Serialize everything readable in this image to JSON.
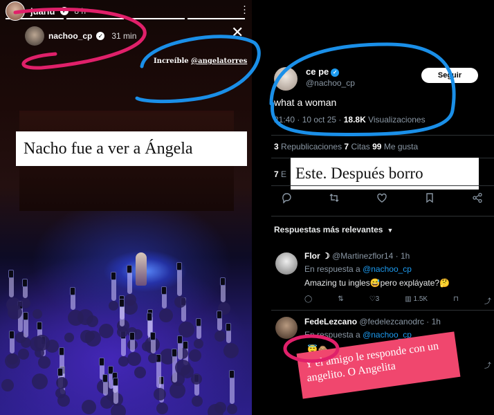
{
  "story": {
    "username": "juariu",
    "time": "8 h",
    "inner_username": "nachoo_cp",
    "inner_time": "31 min",
    "caption_prefix": "Increíble ",
    "caption_mention": "@angelatorres",
    "label": "Nacho fue a ver a Ángela",
    "progress_segments": 4,
    "progress_active": 4
  },
  "tweet": {
    "name": "ce pe",
    "handle": "@nachoo_cp",
    "follow_label": "Seguir",
    "text": "what a woman",
    "time": "21:40 · 10 oct 25 · ",
    "views_count": "18.8K",
    "views_label": " Visualizaciones",
    "reposts_count": "3",
    "reposts_label": " Republicaciones ",
    "quotes_count": "7",
    "quotes_label": " Citas ",
    "likes_count": "99",
    "likes_label": " Me gusta",
    "bookmarks_count": "7",
    "bookmarks_label": " E",
    "label": "Este. Después borro",
    "sort_label": "Respuestas más relevantes"
  },
  "replies": [
    {
      "name": "Flor ☽",
      "handle": " @Martinezflor14 · 1h",
      "reply_prefix": "En respuesta a ",
      "reply_to": "@nachoo_cp",
      "text": "Amazing tu ingles😅pero expláyate?🤔",
      "retweets": "",
      "likes": "3",
      "views": "1.5K"
    },
    {
      "name": "FedeLezcano",
      "handle": " @fedelezcanodrc · 1h",
      "reply_prefix": "En respuesta a ",
      "reply_to": "@nachoo_cp",
      "text": "😇🙈"
    }
  ],
  "annotation_pink": "Y el amigo le responde con un angelito. O Angelita",
  "colors": {
    "verified_blue": "#1d9bf0",
    "annotation_pink": "#f0476e",
    "ring_magenta": "#e0206a",
    "ring_blue": "#1a8fe8"
  },
  "icons": [
    "more-vert-icon",
    "close-icon",
    "verified-icon",
    "reply-icon",
    "repost-icon",
    "like-icon",
    "bookmark-icon",
    "share-icon",
    "chevron-down-icon",
    "views-icon"
  ]
}
